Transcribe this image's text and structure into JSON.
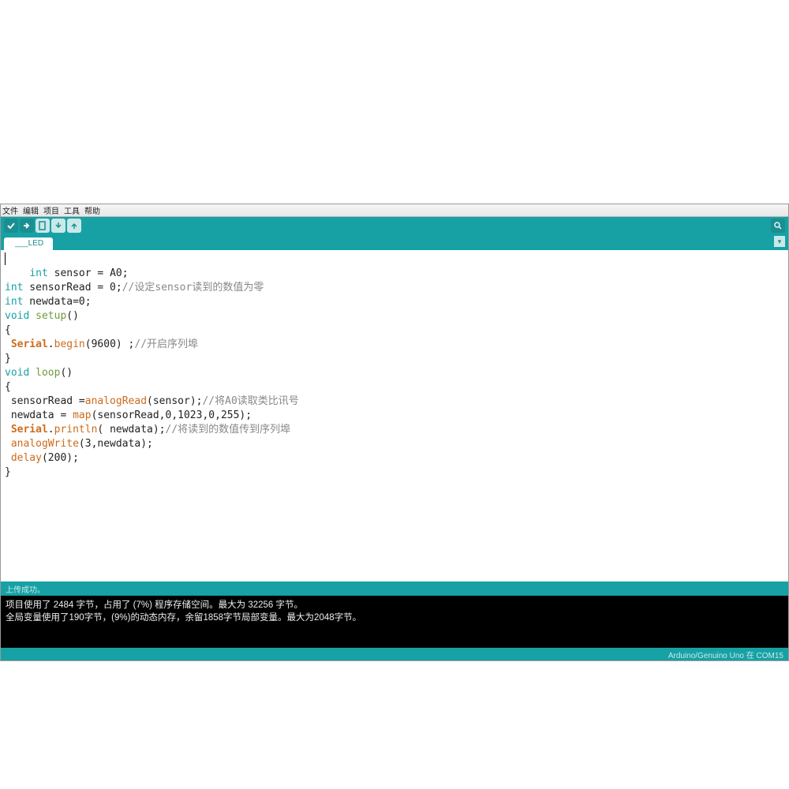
{
  "menu": {
    "file": "文件",
    "edit": "编辑",
    "sketch": "项目",
    "tools": "工具",
    "help": "帮助"
  },
  "tab": {
    "name": "___LED"
  },
  "status": {
    "text": "上传成功。"
  },
  "console": {
    "line1": "项目使用了 2484 字节，占用了 (7%) 程序存储空间。最大为 32256 字节。",
    "line2": "全局变量使用了190字节，(9%)的动态内存，余留1858字节局部变量。最大为2048字节。"
  },
  "footer": {
    "board": "Arduino/Genuino Uno 在 COM15"
  },
  "code": {
    "comment1": "//设定sensor读到的数值为零",
    "comment2": "//开启序列埠",
    "comment3": "//将A0读取类比讯号",
    "comment4": "//将读到的数值传到序列埠",
    "kw_int": "int",
    "kw_void": "void",
    "v_sensor": " sensor = A0;",
    "v_sensorRead": " sensorRead = 0;",
    "v_newdata": " newdata=0;",
    "fn_setup": "setup",
    "fn_loop": "loop",
    "paren": "()",
    "brace_open": "{",
    "brace_close": "}",
    "Serial": "Serial",
    "dot": ".",
    "begin": "begin",
    "println": "println",
    "begin_args": "(9600) ;",
    "loop_assign": " sensorRead =",
    "analogRead": "analogRead",
    "analogRead_args": "(sensor);",
    "newdata_assign": " newdata = ",
    "map": "map",
    "map_args": "(sensorRead,0,1023,0,255);",
    "println_args": "( newdata);",
    "analogWrite": "analogWrite",
    "analogWrite_args": "(3,newdata);",
    "delay": "delay",
    "delay_args": "(200);",
    "space": " "
  }
}
